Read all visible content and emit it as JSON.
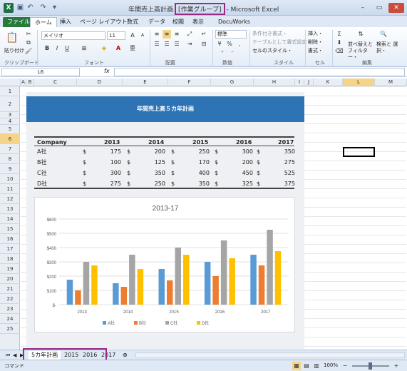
{
  "window": {
    "title_prefix": "年間売上高計画",
    "group_label": "[作業グループ]",
    "title_suffix": "- Microsoft Excel",
    "min": "–",
    "restore": "▭",
    "close": "✕"
  },
  "tabs": [
    "ファイル",
    "ホーム",
    "挿入",
    "ページ レイアウト",
    "数式",
    "データ",
    "校閲",
    "表示",
    "DocuWorks"
  ],
  "ribbon": {
    "paste": "貼り付け",
    "clipboard": "クリップボード",
    "font_name": "メイリオ",
    "font_size": "11",
    "font_group": "フォント",
    "align_group": "配置",
    "number_format": "標準",
    "number_group": "数値",
    "style_items": [
      "条件付き書式・",
      "テーブルとして書式設定・",
      "セルのスタイル・"
    ],
    "style_group": "スタイル",
    "cell_items": [
      "挿入・",
      "削除・",
      "書式・"
    ],
    "cell_group": "セル",
    "sort_filter": "並べ替えと フィルター・",
    "find_select": "検索と 選択・",
    "edit_group": "編集"
  },
  "formula_bar": {
    "name_box": "L6",
    "fx": "fx",
    "value": ""
  },
  "columns": [
    "A",
    "B",
    "C",
    "D",
    "E",
    "F",
    "G",
    "H",
    "I",
    "J",
    "K",
    "L",
    "M"
  ],
  "selected_column": "L",
  "rows": [
    "1",
    "2",
    "3",
    "4",
    "5",
    "6",
    "7",
    "8",
    "9",
    "10",
    "11",
    "12",
    "13",
    "14",
    "15",
    "16",
    "17",
    "18",
    "19",
    "20",
    "21",
    "22",
    "23",
    "24",
    "25"
  ],
  "selected_row": "6",
  "sheet": {
    "banner": "年間売上高５カ年計画",
    "table": {
      "headers": [
        "Company",
        "2013",
        "2014",
        "2015",
        "2016",
        "2017"
      ],
      "currency": "$",
      "rows": [
        {
          "name": "A社",
          "values": [
            "175",
            "200",
            "250",
            "300",
            "350"
          ]
        },
        {
          "name": "B社",
          "values": [
            "100",
            "125",
            "170",
            "200",
            "275"
          ]
        },
        {
          "name": "C社",
          "values": [
            "300",
            "350",
            "400",
            "450",
            "525"
          ]
        },
        {
          "name": "D社",
          "values": [
            "275",
            "250",
            "350",
            "325",
            "375"
          ]
        }
      ]
    }
  },
  "chart_data": {
    "type": "bar",
    "title": "2013-17",
    "categories": [
      "2013",
      "2014",
      "2015",
      "2016",
      "2017"
    ],
    "series": [
      {
        "name": "A社",
        "color": "#5b9bd5",
        "values": [
          175,
          150,
          250,
          300,
          350
        ]
      },
      {
        "name": "B社",
        "color": "#ed7d31",
        "values": [
          100,
          125,
          170,
          200,
          275
        ]
      },
      {
        "name": "C社",
        "color": "#a5a5a5",
        "values": [
          300,
          350,
          400,
          450,
          525
        ]
      },
      {
        "name": "D社",
        "color": "#ffc000",
        "values": [
          275,
          250,
          350,
          325,
          375
        ]
      }
    ],
    "ylim": [
      0,
      600
    ],
    "yticks": [
      "$-",
      "$100",
      "$200",
      "$300",
      "$400",
      "$500",
      "$600"
    ],
    "legend": "bottom",
    "grid": true
  },
  "sheet_tabs": [
    "5カ年計画",
    "2015",
    "2016",
    "2017"
  ],
  "status": {
    "mode": "コマンド",
    "zoom": "100%"
  }
}
